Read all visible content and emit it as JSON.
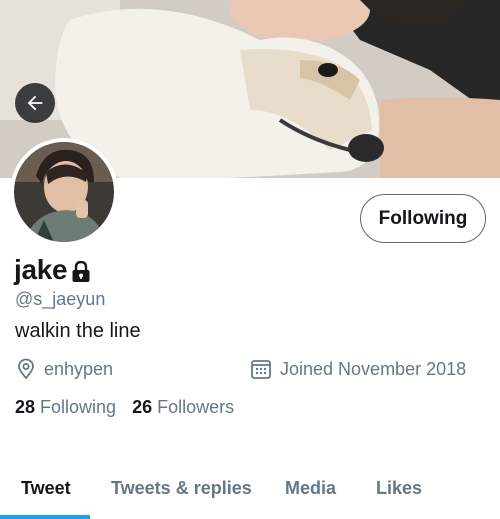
{
  "colors": {
    "accent": "#1da1f2",
    "text_primary": "#14171a",
    "text_secondary": "#657786",
    "back_button_bg": "#14171a"
  },
  "header": {
    "banner_image": "banner-photo",
    "back_icon": "arrow-left-icon"
  },
  "profile": {
    "name": "jake",
    "protected_icon": "lock-icon",
    "handle": "@s_jaeyun",
    "bio": "walkin the line",
    "location": "enhypen",
    "location_icon": "location-pin-icon",
    "joined": "Joined November 2018",
    "joined_icon": "calendar-icon",
    "follow_button_label": "Following"
  },
  "stats": {
    "following_count": "28",
    "following_label": "Following",
    "followers_count": "26",
    "followers_label": "Followers"
  },
  "tabs": [
    {
      "label": "Tweet",
      "active": true
    },
    {
      "label": "Tweets & replies",
      "active": false
    },
    {
      "label": "Media",
      "active": false
    },
    {
      "label": "Likes",
      "active": false
    }
  ]
}
